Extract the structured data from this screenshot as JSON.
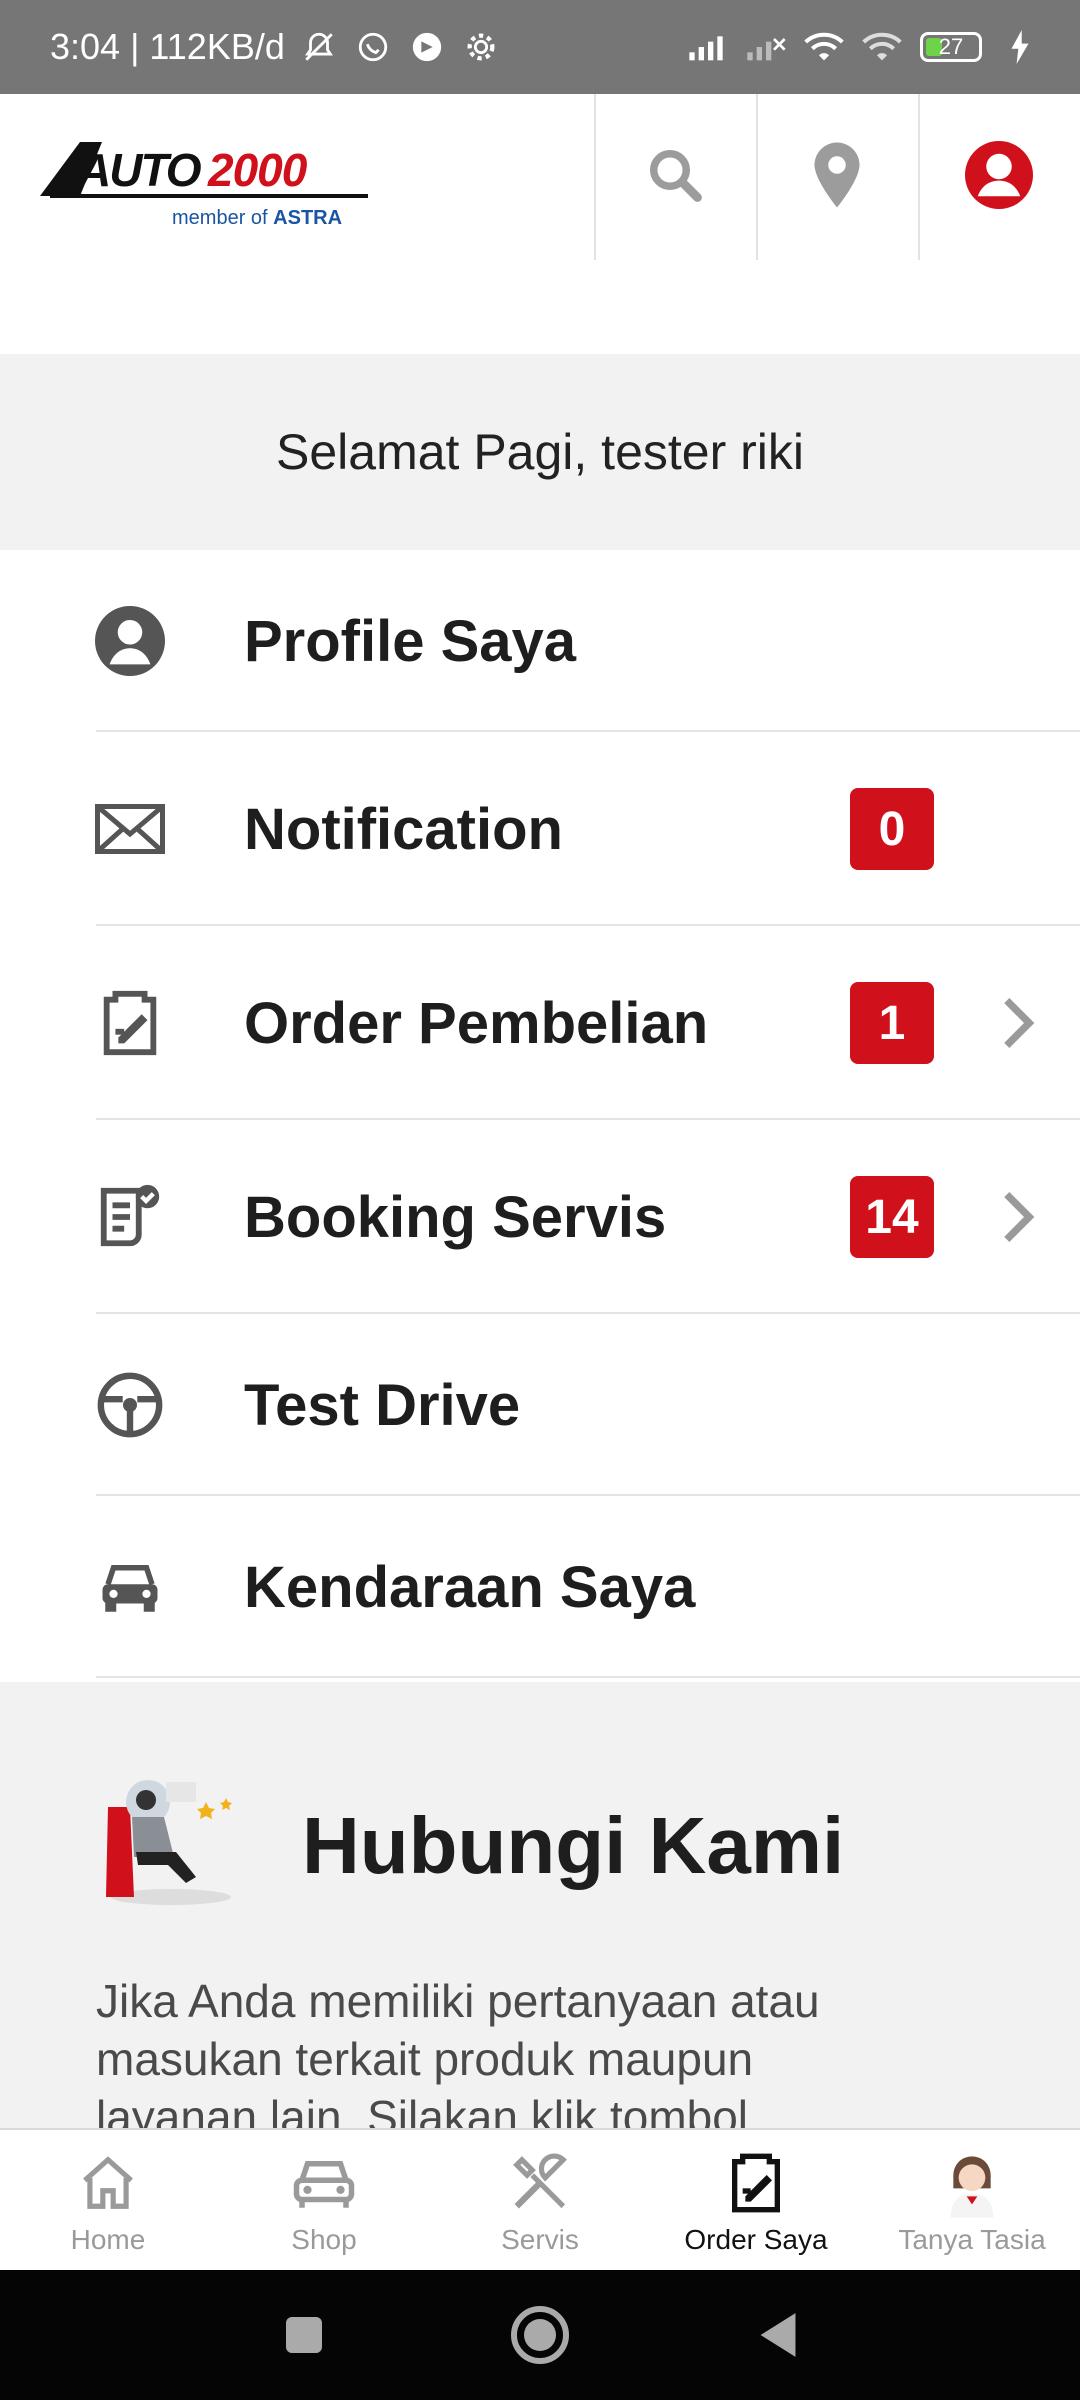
{
  "status_bar": {
    "time_info": "3:04 | 112KB/d",
    "battery": "27"
  },
  "header": {
    "logo_text": "AUTO 2000",
    "logo_sub": "member of ASTRA"
  },
  "greeting": "Selamat Pagi, tester riki",
  "menu": [
    {
      "label": "Profile Saya",
      "icon": "profile-icon"
    },
    {
      "label": "Notification",
      "icon": "envelope-icon",
      "badge": "0"
    },
    {
      "label": "Order Pembelian",
      "icon": "order-icon",
      "badge": "1",
      "chevron": true
    },
    {
      "label": "Booking Servis",
      "icon": "booking-icon",
      "badge": "14",
      "chevron": true
    },
    {
      "label": "Test Drive",
      "icon": "steering-wheel-icon"
    },
    {
      "label": "Kendaraan Saya",
      "icon": "car-icon"
    }
  ],
  "contact": {
    "title": "Hubungi Kami",
    "description": "Jika Anda memiliki pertanyaan atau masukan terkait produk maupun layanan lain, Silakan klik tombol"
  },
  "bottom_nav": [
    {
      "label": "Home"
    },
    {
      "label": "Shop"
    },
    {
      "label": "Servis"
    },
    {
      "label": "Order Saya",
      "active": true
    },
    {
      "label": "Tanya Tasia"
    }
  ],
  "colors": {
    "brand_red": "#d0101b",
    "status_bar": "#767676",
    "section_bg": "#f3f2f2"
  }
}
